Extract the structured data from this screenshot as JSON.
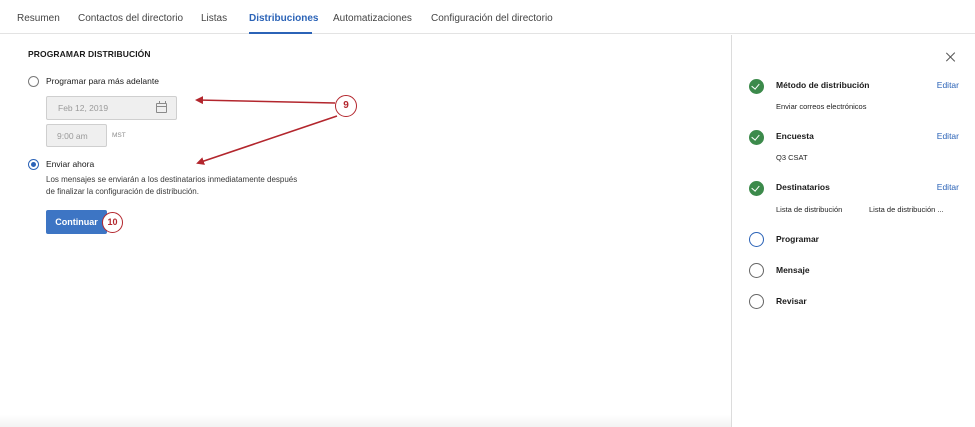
{
  "tabs": [
    {
      "label": "Resumen",
      "active": false
    },
    {
      "label": "Contactos del directorio",
      "active": false
    },
    {
      "label": "Listas",
      "active": false
    },
    {
      "label": "Distribuciones",
      "active": true
    },
    {
      "label": "Automatizaciones",
      "active": false
    },
    {
      "label": "Configuración del directorio",
      "active": false
    }
  ],
  "schedule": {
    "title": "PROGRAMAR DISTRIBUCIÓN",
    "option_later": {
      "label": "Programar para más adelante",
      "selected": false
    },
    "date_value": "Feb 12, 2019",
    "time_value": "9:00 am",
    "timezone": "MST",
    "option_now": {
      "label": "Enviar ahora",
      "selected": true
    },
    "description_lines": [
      "Los mensajes se enviarán a los destinatarios inmediatamente después",
      "de finalizar la configuración de distribución."
    ],
    "continue_label": "Continuar"
  },
  "callouts": {
    "first": "9",
    "second": "10"
  },
  "summary": {
    "steps": [
      {
        "title": "Método de distribución",
        "subtitle": "Enviar correos electrónicos",
        "status": "done",
        "edit": "Editar"
      },
      {
        "title": "Encuesta",
        "subtitle": "Q3 CSAT",
        "status": "done",
        "edit": "Editar"
      },
      {
        "title": "Destinatarios",
        "subtitle": "Lista de distribución",
        "subtitle_value": "Lista de distribución ...",
        "status": "done",
        "edit": "Editar"
      },
      {
        "title": "Programar",
        "status": "current"
      },
      {
        "title": "Mensaje",
        "status": "pending"
      },
      {
        "title": "Revisar",
        "status": "pending"
      }
    ]
  },
  "colors": {
    "accent": "#2b63b7",
    "button": "#3d75c4",
    "success": "#3c8a4b",
    "callout": "#b3262d"
  }
}
